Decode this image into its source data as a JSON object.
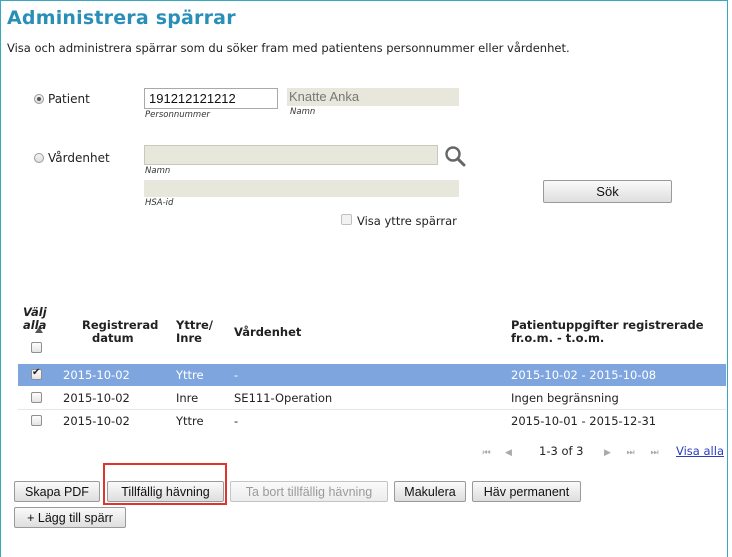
{
  "header": {
    "title": "Administrera spärrar",
    "description": "Visa och administrera spärrar som du söker fram med patientens personnummer eller vårdenhet."
  },
  "search": {
    "patient_label": "Patient",
    "personnummer_value": "191212121212",
    "personnummer_caption": "Personnummer",
    "name_value": "Knatte Anka",
    "name_caption": "Namn",
    "vardenhet_label": "Vårdenhet",
    "vardenhet_name_caption": "Namn",
    "hsa_caption": "HSA-id",
    "search_button": "Sök",
    "outer_label": "Visa yttre spärrar",
    "selected": "patient"
  },
  "table": {
    "headers": {
      "select_all_line1": "Välj",
      "select_all_line2": "alla",
      "date_line1": "Registrerad",
      "date_line2": "datum",
      "type_line1": "Yttre/",
      "type_line2": "Inre",
      "unit": "Vårdenhet",
      "period_line1": "Patientuppgifter registrerade",
      "period_line2": "fr.o.m. - t.o.m."
    },
    "rows": [
      {
        "date": "2015-10-02",
        "type": "Yttre",
        "unit": "-",
        "period": "2015-10-02 - 2015-10-08",
        "checked": true,
        "selected": true
      },
      {
        "date": "2015-10-02",
        "type": "Inre",
        "unit": "SE111-Operation",
        "period": "Ingen begränsning",
        "checked": false,
        "selected": false
      },
      {
        "date": "2015-10-02",
        "type": "Yttre",
        "unit": "-",
        "period": "2015-10-01 - 2015-12-31",
        "checked": false,
        "selected": false
      }
    ],
    "pager": {
      "range": "1-3 of 3",
      "show_all": "Visa alla"
    }
  },
  "actions": {
    "pdf": "Skapa PDF",
    "temporary_lift": "Tillfällig hävning",
    "remove_temporary_lift": "Ta bort tillfällig hävning",
    "cancel": "Makulera",
    "lift_permanent": "Häv permanent",
    "add_block": "+ Lägg till spärr"
  },
  "colors": {
    "title": "#2a8fb8",
    "selected_row": "#7fa5df",
    "highlight_box": "#e0352f"
  }
}
